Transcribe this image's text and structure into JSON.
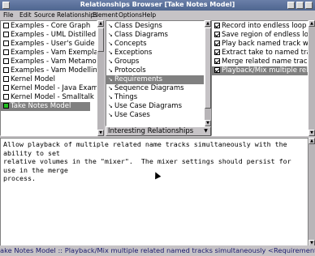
{
  "window": {
    "title": "Relationships Browser [Take Notes Model]"
  },
  "menu": [
    "File",
    "Edit",
    "Source",
    "Relationships",
    "Element",
    "Options",
    "Help"
  ],
  "models": [
    {
      "label": "Examples - Core Graph",
      "selected": false,
      "green": false
    },
    {
      "label": "Examples - UML Distilled",
      "selected": false,
      "green": false
    },
    {
      "label": "Examples - User's Guide Ex",
      "selected": false,
      "green": false
    },
    {
      "label": "Examples - Vam Exemplar",
      "selected": false,
      "green": false
    },
    {
      "label": "Examples - Vam Metamode",
      "selected": false,
      "green": false
    },
    {
      "label": "Examples - Vam Modelling",
      "selected": false,
      "green": false
    },
    {
      "label": "Kernel Model",
      "selected": false,
      "green": false
    },
    {
      "label": "Kernel Model - Java Exam",
      "selected": false,
      "green": false
    },
    {
      "label": "Kernel Model - Smalltalk E",
      "selected": false,
      "green": false
    },
    {
      "label": "Take Notes Model",
      "selected": true,
      "green": true
    }
  ],
  "categories": [
    {
      "label": "Class Designs",
      "selected": false
    },
    {
      "label": "Class Diagrams",
      "selected": false
    },
    {
      "label": "Concepts",
      "selected": false
    },
    {
      "label": "Exceptions",
      "selected": false
    },
    {
      "label": "Groups",
      "selected": false
    },
    {
      "label": "Protocols",
      "selected": false
    },
    {
      "label": "Requirements",
      "selected": true
    },
    {
      "label": "Sequence Diagrams",
      "selected": false
    },
    {
      "label": "Things",
      "selected": false
    },
    {
      "label": "Use Case Diagrams",
      "selected": false
    },
    {
      "label": "Use Cases",
      "selected": false
    }
  ],
  "relationship_filter": "Interesting Relationships",
  "requirements": [
    {
      "label": "Record into endless loop",
      "selected": false
    },
    {
      "label": "Save region of endless loo",
      "selected": false
    },
    {
      "label": "Play back named track wh",
      "selected": false
    },
    {
      "label": "Extract take to named tra",
      "selected": false
    },
    {
      "label": "Merge related name tracks",
      "selected": false
    },
    {
      "label": "Playback/Mix multiple rela",
      "selected": true
    }
  ],
  "description": "Allow playback of multiple related name tracks simultaneously with the ability to set\nrelative volumes in the \"mixer\".  The mixer settings should persist for use in the merge\nprocess.",
  "status": "ake Notes Model :: Playback/Mix multiple related named tracks simultaneously <Requirement"
}
